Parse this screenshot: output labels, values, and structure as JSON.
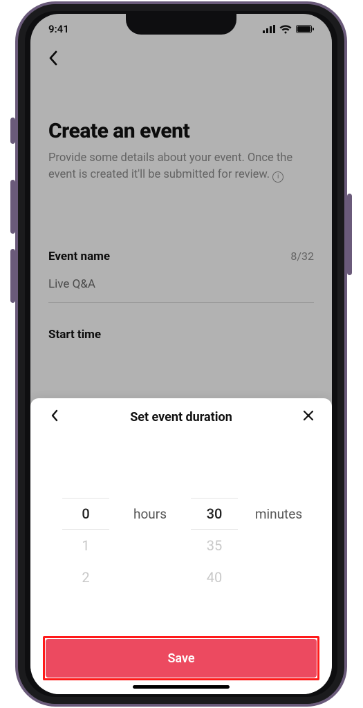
{
  "status": {
    "time": "9:41"
  },
  "page": {
    "title": "Create an event",
    "subtitle": "Provide some details about your event. Once the event is created it'll be submitted for review."
  },
  "form": {
    "event_name": {
      "label": "Event name",
      "value": "Live Q&A",
      "counter": "8/32"
    },
    "start_time": {
      "label": "Start time"
    }
  },
  "sheet": {
    "title": "Set event duration",
    "hours": {
      "unit": "hours",
      "selected": "0",
      "options": [
        "0",
        "1",
        "2"
      ]
    },
    "minutes": {
      "unit": "minutes",
      "selected": "30",
      "options": [
        "30",
        "35",
        "40"
      ]
    },
    "save_label": "Save"
  },
  "colors": {
    "accent": "#ec4a60",
    "highlight": "#ff1a1a"
  }
}
